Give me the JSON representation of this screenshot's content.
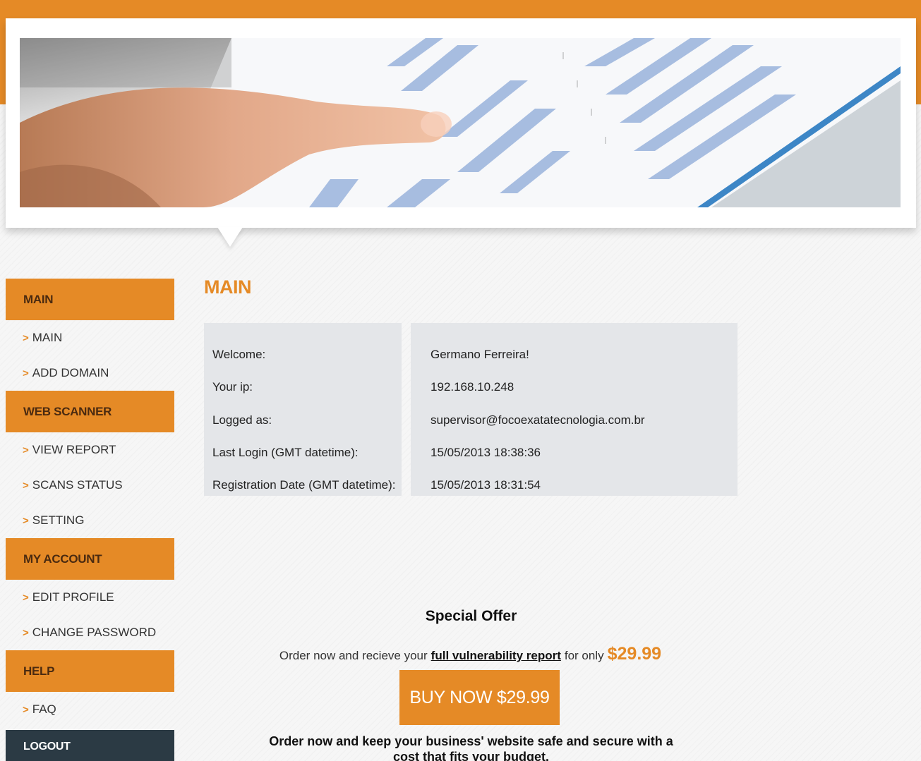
{
  "banner": {
    "image": "finger-pointing-at-bar-chart-photo"
  },
  "colors": {
    "accent": "#e58a26",
    "dark": "#2b3a44",
    "info_bg": "#e4e6e9"
  },
  "sidebar": {
    "sections": [
      {
        "label": "MAIN",
        "items": [
          "MAIN",
          "ADD DOMAIN"
        ]
      },
      {
        "label": "WEB SCANNER",
        "items": [
          "VIEW REPORT",
          "SCANS STATUS",
          "SETTING"
        ]
      },
      {
        "label": "MY ACCOUNT",
        "items": [
          "EDIT PROFILE",
          "CHANGE PASSWORD"
        ]
      },
      {
        "label": "HELP",
        "items": [
          "FAQ"
        ]
      }
    ],
    "chevron": ">",
    "logout": "LOGOUT"
  },
  "main": {
    "title": "MAIN",
    "info": {
      "rows": [
        {
          "label": "Welcome:",
          "value": "Germano Ferreira!"
        },
        {
          "label": "Your ip:",
          "value": "192.168.10.248"
        },
        {
          "label": "Logged as:",
          "value": "supervisor@focoexatatecnologia.com.br"
        },
        {
          "label": "Last Login (GMT datetime):",
          "value": "15/05/2013 18:38:36"
        },
        {
          "label": "Registration Date (GMT datetime):",
          "value": "15/05/2013 18:31:54"
        }
      ]
    }
  },
  "offer": {
    "title": "Special Offer",
    "line_prefix": "Order now and recieve your",
    "link_text": "full vulnerability report",
    "line_middle": "for only",
    "price": "$29.99",
    "button_label": "BUY NOW $29.99",
    "bottom_text": "Order now and keep your business' website safe and secure with a cost that fits your budget."
  }
}
